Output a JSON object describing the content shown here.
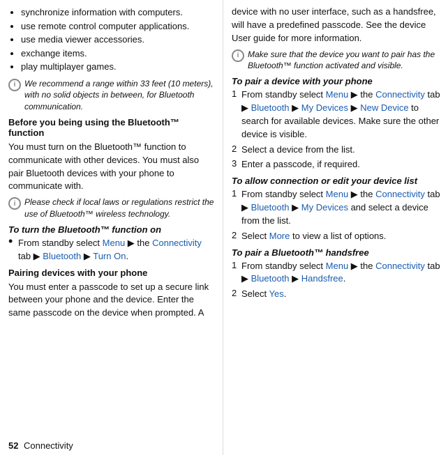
{
  "left": {
    "bullets": [
      "synchronize information with computers.",
      "use remote control computer applications.",
      "use media viewer accessories.",
      "exchange items.",
      "play multiplayer games."
    ],
    "note1": "We recommend a range within 33 feet (10 meters), with no solid objects in between, for Bluetooth communication.",
    "section1_heading": "Before you being using the Bluetooth™ function",
    "section1_body": "You must turn on the Bluetooth™ function to communicate with other devices. You must also pair Bluetooth devices with your phone to communicate with.",
    "note2": "Please check if local laws or regulations restrict the use of Bluetooth™ wireless technology.",
    "sub1": "To turn the Bluetooth™ function on",
    "turn_on_step": "From standby select",
    "turn_on_menu": "Menu",
    "turn_on_arrow1": " ▶ the ",
    "turn_on_conn": "Connectivity",
    "turn_on_arrow2": " tab ▶ ",
    "turn_on_bt": "Bluetooth",
    "turn_on_arrow3": " ▶ ",
    "turn_on_end": "Turn On",
    "pairing_heading": "Pairing devices with your phone",
    "pairing_body": "You must enter a passcode to set up a secure link between your phone and the device. Enter the same passcode on the device when prompted. A",
    "footer_num": "52",
    "footer_label": "Connectivity"
  },
  "right": {
    "intro": "device with no user interface, such as a handsfree, will have a predefined passcode. See the device User guide for more information.",
    "note3": "Make sure that the device you want to pair has the Bluetooth™ function activated and visible.",
    "sub2": "To pair a device with your phone",
    "pair_steps": [
      {
        "num": "1",
        "text_prefix": "From standby select ",
        "menu": "Menu",
        "a1": " ▶ the ",
        "conn": "Connectivity",
        "a2": " tab ▶ ",
        "bt": "Bluetooth",
        "a3": " ▶ ",
        "mydev": "My Devices",
        "a4": " ▶ ",
        "newdev": "New Device",
        "suffix": " to search for available devices. Make sure the other device is visible."
      },
      {
        "num": "2",
        "text": "Select a device from the list."
      },
      {
        "num": "3",
        "text": "Enter a passcode, if required."
      }
    ],
    "sub3": "To allow connection or edit your device list",
    "conn_steps": [
      {
        "num": "1",
        "text_prefix": "From standby select ",
        "menu": "Menu",
        "a1": " ▶ the ",
        "conn": "Connectivity",
        "a2": " tab ▶ ",
        "bt": "Bluetooth",
        "a3": " ▶ ",
        "mydev": "My Devices",
        "suffix": " and select a device from the list."
      },
      {
        "num": "2",
        "text_prefix": "Select ",
        "more": "More",
        "suffix": " to view a list of options."
      }
    ],
    "sub4": "To pair a Bluetooth™ handsfree",
    "hands_steps": [
      {
        "num": "1",
        "text_prefix": "From standby select ",
        "menu": "Menu",
        "a1": " ▶ the ",
        "conn": "Connectivity",
        "a2": " tab ▶ ",
        "bt": "Bluetooth",
        "a3": " ▶ ",
        "hands": "Handsfree",
        "suffix": "."
      },
      {
        "num": "2",
        "text_prefix": "Select ",
        "yes": "Yes",
        "suffix": "."
      }
    ]
  }
}
